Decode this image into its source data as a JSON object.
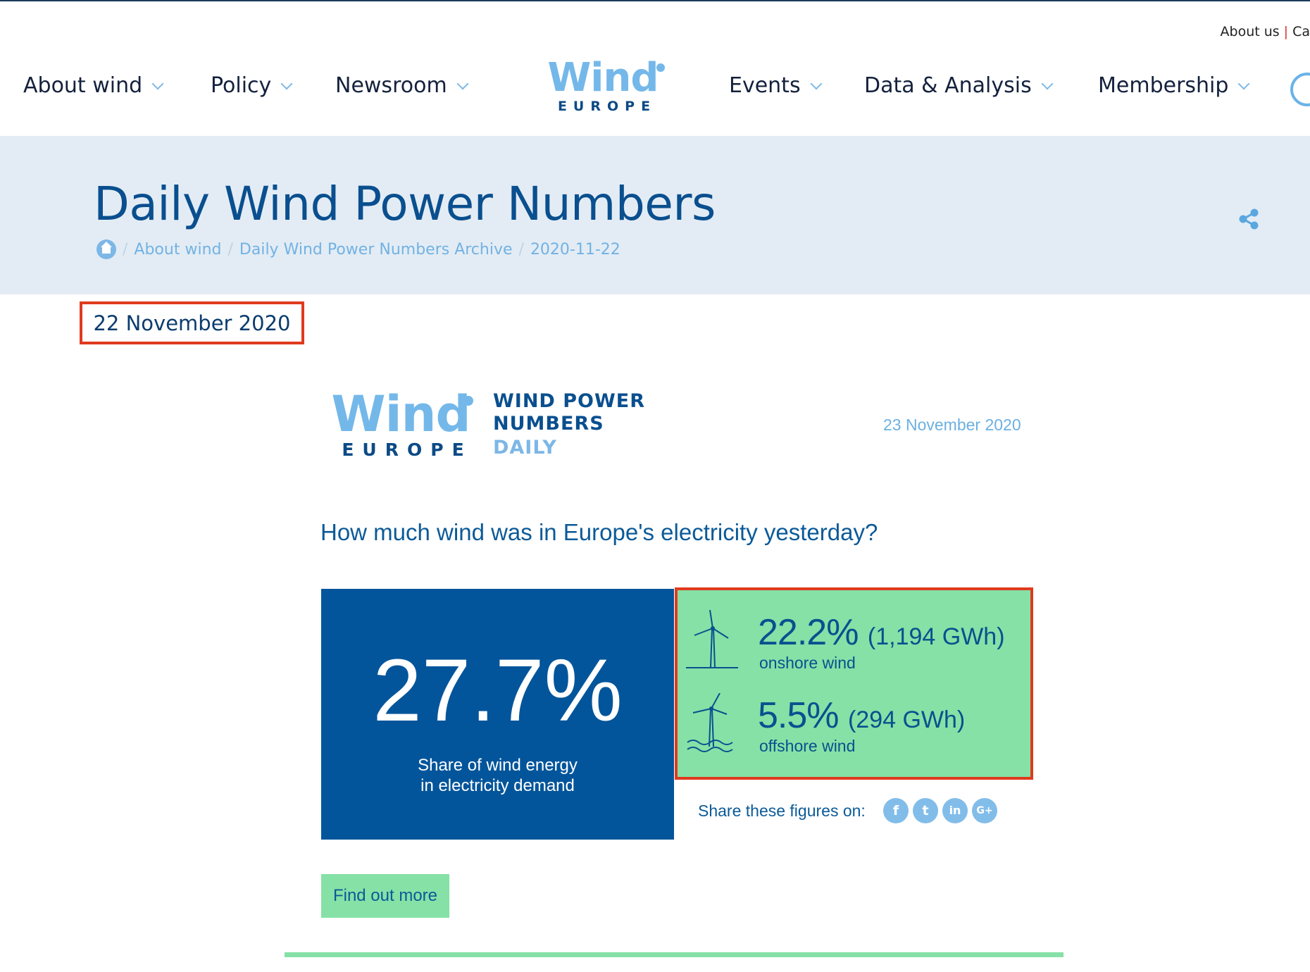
{
  "utility_links": {
    "about_us": "About us",
    "contact_partial": "Ca"
  },
  "nav": {
    "left": [
      "About wind",
      "Policy",
      "Newsroom"
    ],
    "right": [
      "Events",
      "Data & Analysis",
      "Membership"
    ],
    "search_icon": "search-icon"
  },
  "logo": {
    "word": "Wind",
    "sub": "EUROPE"
  },
  "hero": {
    "title": "Daily Wind Power Numbers",
    "breadcrumb": [
      "About wind",
      "Daily Wind Power Numbers Archive",
      "2020-11-22"
    ],
    "share_icon": "share-icon"
  },
  "page_date": "22 November 2020",
  "newsletter": {
    "heading_line1": "WIND POWER",
    "heading_line2": "NUMBERS",
    "heading_line3": "DAILY",
    "date": "23 November 2020",
    "question": "How much wind was in Europe's electricity yesterday?",
    "share_label": "Share these figures on:",
    "social": [
      "f",
      "t",
      "in",
      "G+"
    ],
    "find_out_more": "Find out more"
  },
  "stats": {
    "total_share": "27.7%",
    "total_caption_line1": "Share of wind energy",
    "total_caption_line2": "in electricity demand",
    "onshore_pct": "22.2%",
    "onshore_gwh": "(1,194 GWh)",
    "onshore_label": "onshore wind",
    "offshore_pct": "5.5%",
    "offshore_gwh": "(294 GWh)",
    "offshore_label": "offshore wind"
  },
  "colors": {
    "brand_dark_blue": "#02559b",
    "brand_light_blue": "#74b8ea",
    "accent_green": "#85e1a6",
    "highlight_red": "#e03a1e",
    "hero_bg": "#e3ecf4"
  }
}
